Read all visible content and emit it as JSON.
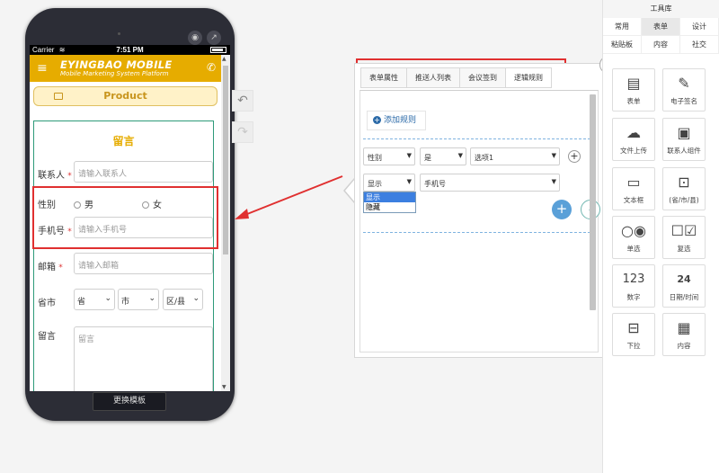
{
  "phone": {
    "carrier": "Carrier",
    "time": "7:51 PM",
    "brand": "EYINGBAO MOBILE",
    "slogan": "Mobile Marketing System Platform",
    "product_label": "Product",
    "form_title": "留言",
    "fields": {
      "contact_label": "联系人",
      "contact_placeholder": "请输入联系人",
      "gender_label": "性别",
      "gender_male": "男",
      "gender_female": "女",
      "mobile_label": "手机号",
      "mobile_placeholder": "请输入手机号",
      "email_label": "邮箱",
      "email_placeholder": "请输入邮箱",
      "region_label": "省市",
      "province": "省",
      "city": "市",
      "county": "区/县",
      "message_label": "留言",
      "message_placeholder": "留言"
    },
    "required_mark": "*",
    "switch_template": "更换模板"
  },
  "panel": {
    "tabs": [
      "表单属性",
      "推送人列表",
      "会议签到",
      "逻辑规则"
    ],
    "add_rule": "添加规则",
    "rule": {
      "field": "性别",
      "operator": "是",
      "value": "选项1",
      "action": "显示",
      "target": "手机号"
    },
    "action_options": [
      "显示",
      "隐藏"
    ],
    "add_symbol": "+",
    "remove_symbol": "-"
  },
  "toolbox": {
    "title": "工具库",
    "tabs": [
      "常用",
      "表单",
      "设计",
      "粘贴板",
      "内容",
      "社交"
    ],
    "active_tab": "表单",
    "items": [
      {
        "label": "表单",
        "icon": "form-icon"
      },
      {
        "label": "电子签名",
        "icon": "pen-icon"
      },
      {
        "label": "文件上传",
        "icon": "cloud-upload-icon"
      },
      {
        "label": "联系人组件",
        "icon": "contact-card-icon"
      },
      {
        "label": "文本框",
        "icon": "textbox-icon"
      },
      {
        "label": "(省/市/县)",
        "icon": "region-icon"
      },
      {
        "label": "单选",
        "icon": "radio-icon"
      },
      {
        "label": "复选",
        "icon": "checkbox-icon"
      },
      {
        "label": "数字",
        "icon": "number-icon"
      },
      {
        "label": "日期/时间",
        "icon": "calendar-icon"
      },
      {
        "label": "下拉",
        "icon": "dropdown-icon"
      },
      {
        "label": "内容",
        "icon": "content-icon"
      }
    ],
    "number_glyph": "123",
    "calendar_day": "24"
  },
  "colors": {
    "brand": "#e6ac00",
    "highlight": "#e03030",
    "link": "#2b6aa8"
  }
}
